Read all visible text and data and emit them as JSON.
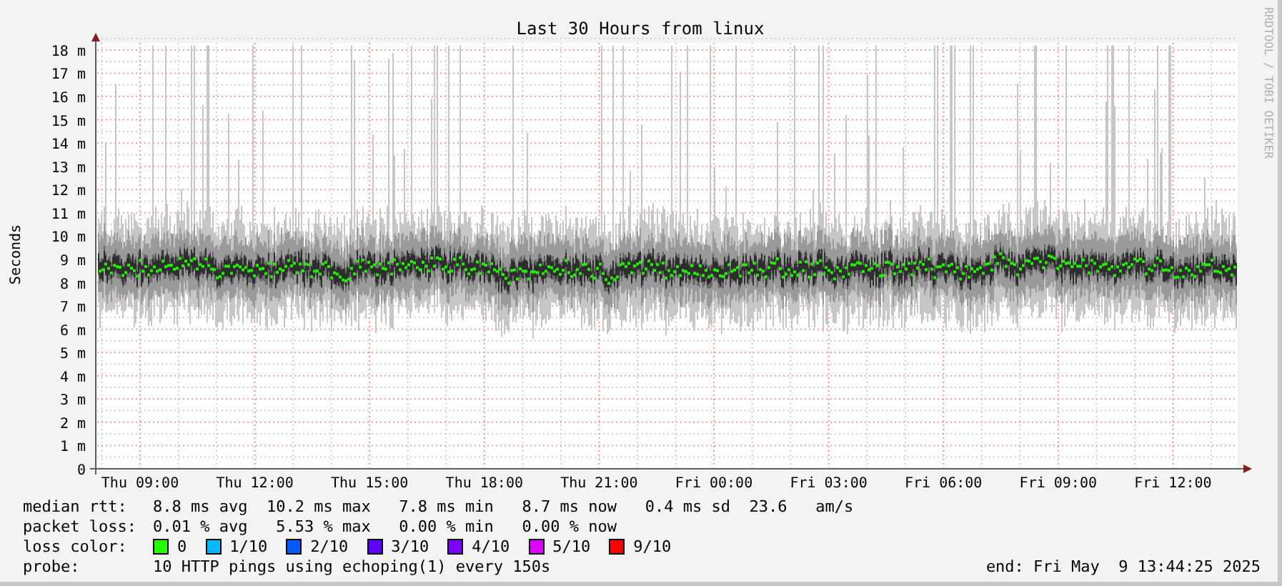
{
  "title": "Last 30 Hours from linux",
  "y_axis": {
    "label": "Seconds",
    "ticks": [
      "18 m",
      "17 m",
      "16 m",
      "15 m",
      "14 m",
      "13 m",
      "12 m",
      "11 m",
      "10 m",
      "9 m",
      "8 m",
      "7 m",
      "6 m",
      "5 m",
      "4 m",
      "3 m",
      "2 m",
      "1 m",
      "0"
    ]
  },
  "x_axis": {
    "ticks": [
      "Thu 09:00",
      "Thu 12:00",
      "Thu 15:00",
      "Thu 18:00",
      "Thu 21:00",
      "Fri 00:00",
      "Fri 03:00",
      "Fri 06:00",
      "Fri 09:00",
      "Fri 12:00"
    ]
  },
  "credit": "RRDTOOL / TOBI OETIKER",
  "legend": {
    "median_rtt": {
      "label": "median rtt:",
      "value": "8.8 ms avg  10.2 ms max   7.8 ms min   8.7 ms now   0.4 ms sd  23.6   am/s"
    },
    "packet_loss": {
      "label": "packet loss:",
      "value": "0.01 % avg   5.53 % max   0.00 % min   0.00 % now"
    },
    "loss_color_label": "loss color:",
    "loss_colors": [
      {
        "label": "0",
        "color": "#26ff00"
      },
      {
        "label": "1/10",
        "color": "#00b8ff"
      },
      {
        "label": "2/10",
        "color": "#0059ff"
      },
      {
        "label": "3/10",
        "color": "#5e00ff"
      },
      {
        "label": "4/10",
        "color": "#7e00ff"
      },
      {
        "label": "5/10",
        "color": "#dd00ff"
      },
      {
        "label": "9/10",
        "color": "#ff0000"
      }
    ],
    "probe": {
      "label": "probe:",
      "value": "10 HTTP pings using echoping(1) every 150s"
    },
    "end": "end: Fri May  9 13:44:25 2025"
  }
}
